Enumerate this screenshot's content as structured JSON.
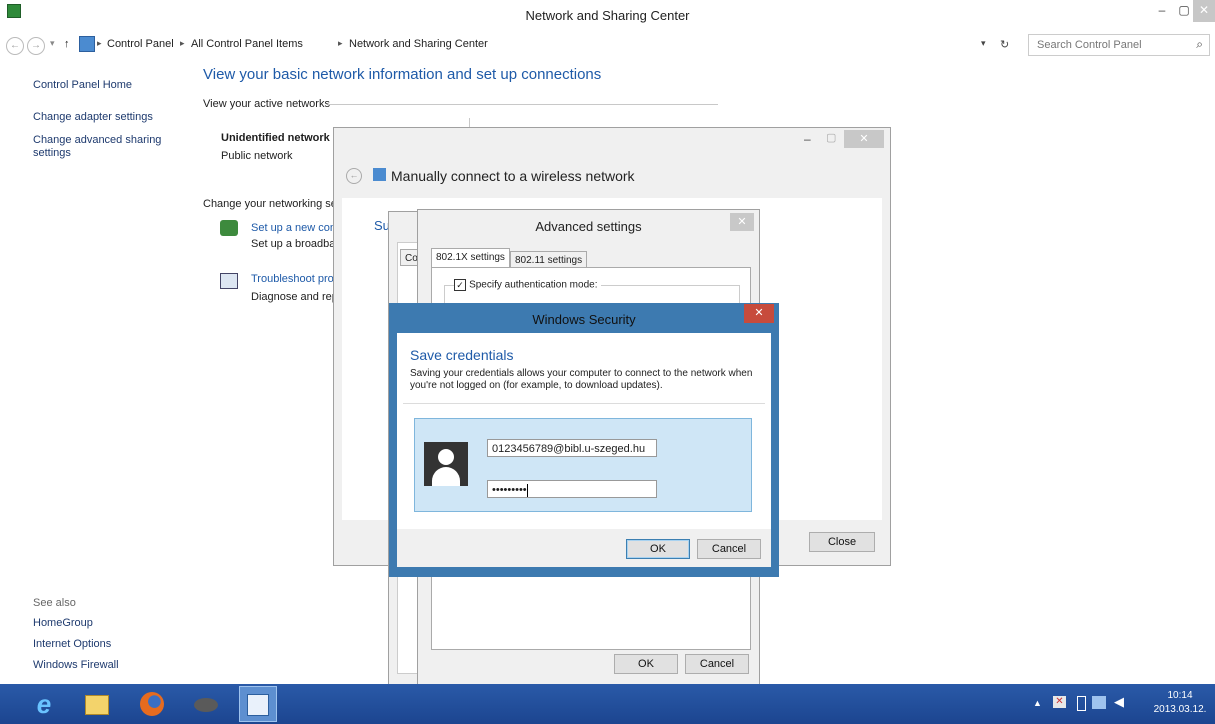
{
  "window": {
    "title": "Network and Sharing Center",
    "controls": {
      "minimize": "–",
      "maximize": "▢",
      "close": "✕"
    }
  },
  "address": {
    "breadcrumb": [
      "Control Panel",
      "All Control Panel Items",
      "Network and Sharing Center"
    ],
    "search_placeholder": "Search Control Panel"
  },
  "sidebar": {
    "home": "Control Panel Home",
    "items": [
      "Change adapter settings",
      "Change advanced sharing settings"
    ],
    "see_also_label": "See also",
    "see_also": [
      "HomeGroup",
      "Internet Options",
      "Windows Firewall"
    ]
  },
  "main": {
    "heading": "View your basic network information and set up connections",
    "active_networks_label": "View your active networks",
    "network_name": "Unidentified network",
    "network_type": "Public network",
    "change_settings_label": "Change your networking se",
    "tasks": [
      {
        "title": "Set up a new con",
        "desc": "Set up a broadbar"
      },
      {
        "title": "Troubleshoot pro",
        "desc": "Diagnose and rep"
      }
    ]
  },
  "wizard": {
    "title": "Manually connect to a wireless network",
    "partial_heading": "Su",
    "close_button": "Close"
  },
  "advanced": {
    "title": "Advanced settings",
    "tabs": [
      "802.1X settings",
      "802.11 settings"
    ],
    "partial_tab": "Co",
    "specify_auth_label": "Specify authentication mode:",
    "specify_auth_checked": true,
    "ok": "OK",
    "cancel": "Cancel"
  },
  "security": {
    "title": "Windows Security",
    "heading": "Save credentials",
    "message": "Saving your credentials allows your computer to connect to the network when you're not logged on (for example, to download updates).",
    "username": "0123456789@bibl.u-szeged.hu",
    "password_masked": "•••••••••",
    "ok": "OK",
    "cancel": "Cancel"
  },
  "taskbar": {
    "time": "10:14",
    "date": "2013.03.12."
  },
  "colors": {
    "accent": "#1e5aa8",
    "security_frame": "#3d7ab0",
    "close_red": "#c74b3c",
    "taskbar": "#1c4590"
  }
}
